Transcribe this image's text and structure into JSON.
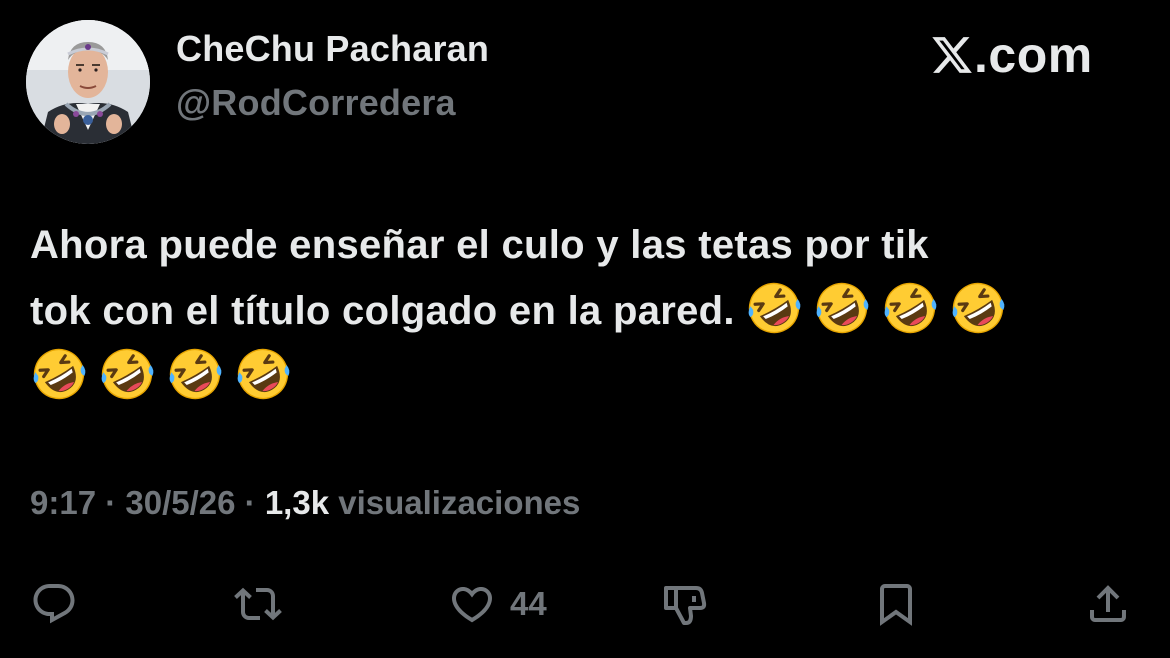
{
  "user": {
    "display_name": "CheChu Pacharan",
    "handle": "@RodCorredera",
    "avatar_icon": "profile-photo"
  },
  "brand": {
    "text": ".com",
    "logo_icon": "x-logo-icon"
  },
  "tweet": {
    "line1": "Ahora puede enseñar el culo y las tetas por tik",
    "line2": "tok con el título colgado en la pared.",
    "emoji_name": "rolling-on-the-floor-laughing-emoji",
    "emoji_count": 8
  },
  "meta": {
    "time": "9:17",
    "separator": " · ",
    "date": "30/5/26",
    "views_count": "1,3k",
    "views_label": "visualizaciones"
  },
  "actions": {
    "reply_icon": "reply-icon",
    "repost_icon": "repost-icon",
    "like_icon": "heart-icon",
    "like_count": "44",
    "dislike_icon": "thumbs-down-icon",
    "bookmark_icon": "bookmark-icon",
    "share_icon": "share-icon"
  },
  "colors": {
    "background": "#000000",
    "primary_text": "#e7e9ea",
    "secondary_text": "#71767b"
  }
}
